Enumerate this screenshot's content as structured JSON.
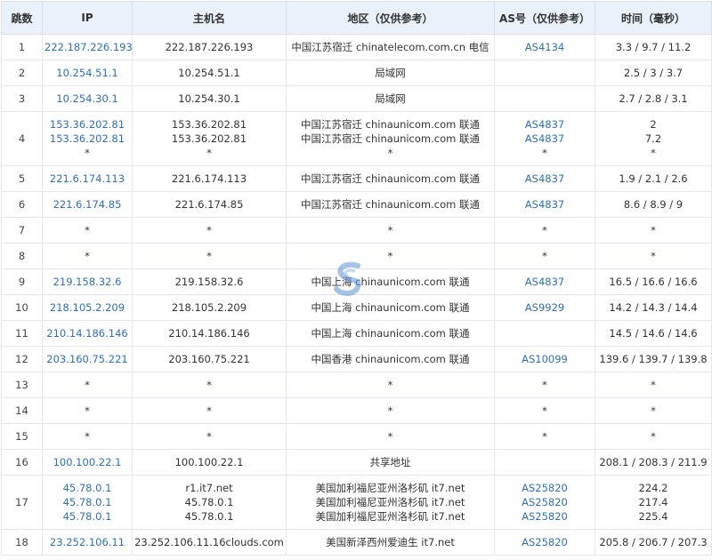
{
  "headers": [
    "跳数",
    "IP",
    "主机名",
    "地区（仅供参考）",
    "AS号（仅供参考）",
    "时间（毫秒）"
  ],
  "rows": [
    {
      "hop": "1",
      "ip": [
        "222.187.226.193"
      ],
      "host": [
        "222.187.226.193"
      ],
      "region": [
        "中国江苏宿迁 chinatelecom.com.cn 电信"
      ],
      "as": [
        "AS4134"
      ],
      "time": [
        "3.3 / 9.7 / 11.2"
      ]
    },
    {
      "hop": "2",
      "ip": [
        "10.254.51.1"
      ],
      "host": [
        "10.254.51.1"
      ],
      "region": [
        "局域网"
      ],
      "as": [
        ""
      ],
      "time": [
        "2.5 / 3 / 3.7"
      ]
    },
    {
      "hop": "3",
      "ip": [
        "10.254.30.1"
      ],
      "host": [
        "10.254.30.1"
      ],
      "region": [
        "局域网"
      ],
      "as": [
        ""
      ],
      "time": [
        "2.7 / 2.8 / 3.1"
      ]
    },
    {
      "hop": "4",
      "ip": [
        "153.36.202.81",
        "153.36.202.81",
        "*"
      ],
      "host": [
        "153.36.202.81",
        "153.36.202.81",
        "*"
      ],
      "region": [
        "中国江苏宿迁 chinaunicom.com 联通",
        "中国江苏宿迁 chinaunicom.com 联通",
        "*"
      ],
      "as": [
        "AS4837",
        "AS4837",
        "*"
      ],
      "time": [
        "2",
        "7.2",
        "*"
      ]
    },
    {
      "hop": "5",
      "ip": [
        "221.6.174.113"
      ],
      "host": [
        "221.6.174.113"
      ],
      "region": [
        "中国江苏宿迁 chinaunicom.com 联通"
      ],
      "as": [
        "AS4837"
      ],
      "time": [
        "1.9 / 2.1 / 2.6"
      ]
    },
    {
      "hop": "6",
      "ip": [
        "221.6.174.85"
      ],
      "host": [
        "221.6.174.85"
      ],
      "region": [
        "中国江苏宿迁 chinaunicom.com 联通"
      ],
      "as": [
        "AS4837"
      ],
      "time": [
        "8.6 / 8.9 / 9"
      ]
    },
    {
      "hop": "7",
      "ip": [
        "*"
      ],
      "host": [
        "*"
      ],
      "region": [
        "*"
      ],
      "as": [
        "*"
      ],
      "time": [
        "*"
      ]
    },
    {
      "hop": "8",
      "ip": [
        "*"
      ],
      "host": [
        "*"
      ],
      "region": [
        "*"
      ],
      "as": [
        "*"
      ],
      "time": [
        "*"
      ]
    },
    {
      "hop": "9",
      "ip": [
        "219.158.32.6"
      ],
      "host": [
        "219.158.32.6"
      ],
      "region": [
        "中国上海 chinaunicom.com 联通"
      ],
      "as": [
        "AS4837"
      ],
      "time": [
        "16.5 / 16.6 / 16.6"
      ]
    },
    {
      "hop": "10",
      "ip": [
        "218.105.2.209"
      ],
      "host": [
        "218.105.2.209"
      ],
      "region": [
        "中国上海 chinaunicom.com 联通"
      ],
      "as": [
        "AS9929"
      ],
      "time": [
        "14.2 / 14.3 / 14.4"
      ]
    },
    {
      "hop": "11",
      "ip": [
        "210.14.186.146"
      ],
      "host": [
        "210.14.186.146"
      ],
      "region": [
        "中国上海 chinaunicom.com 联通"
      ],
      "as": [
        ""
      ],
      "time": [
        "14.5 / 14.6 / 14.6"
      ]
    },
    {
      "hop": "12",
      "ip": [
        "203.160.75.221"
      ],
      "host": [
        "203.160.75.221"
      ],
      "region": [
        "中国香港 chinaunicom.com 联通"
      ],
      "as": [
        "AS10099"
      ],
      "time": [
        "139.6 / 139.7 / 139.8"
      ]
    },
    {
      "hop": "13",
      "ip": [
        "*"
      ],
      "host": [
        "*"
      ],
      "region": [
        "*"
      ],
      "as": [
        "*"
      ],
      "time": [
        "*"
      ]
    },
    {
      "hop": "14",
      "ip": [
        "*"
      ],
      "host": [
        "*"
      ],
      "region": [
        "*"
      ],
      "as": [
        "*"
      ],
      "time": [
        "*"
      ]
    },
    {
      "hop": "15",
      "ip": [
        "*"
      ],
      "host": [
        "*"
      ],
      "region": [
        "*"
      ],
      "as": [
        "*"
      ],
      "time": [
        "*"
      ]
    },
    {
      "hop": "16",
      "ip": [
        "100.100.22.1"
      ],
      "host": [
        "100.100.22.1"
      ],
      "region": [
        "共享地址"
      ],
      "as": [
        ""
      ],
      "time": [
        "208.1 / 208.3 / 211.9"
      ]
    },
    {
      "hop": "17",
      "ip": [
        "45.78.0.1",
        "45.78.0.1",
        "45.78.0.1"
      ],
      "host": [
        "r1.it7.net",
        "45.78.0.1",
        "45.78.0.1"
      ],
      "region": [
        "美国加利福尼亚州洛杉矶 it7.net",
        "美国加利福尼亚州洛杉矶 it7.net",
        "美国加利福尼亚州洛杉矶 it7.net"
      ],
      "as": [
        "AS25820",
        "AS25820",
        "AS25820"
      ],
      "time": [
        "224.2",
        "217.4",
        "225.4"
      ]
    },
    {
      "hop": "18",
      "ip": [
        "23.252.106.11"
      ],
      "host": [
        "23.252.106.11.16clouds.com"
      ],
      "region": [
        "美国新泽西州爱迪生 it7.net"
      ],
      "as": [
        "AS25820"
      ],
      "time": [
        "205.8 / 206.7 / 207.3"
      ]
    }
  ],
  "colors": {
    "link": "#2e6fbd",
    "header_bg": "#eaf1fb",
    "border": "#e4e7ed"
  }
}
